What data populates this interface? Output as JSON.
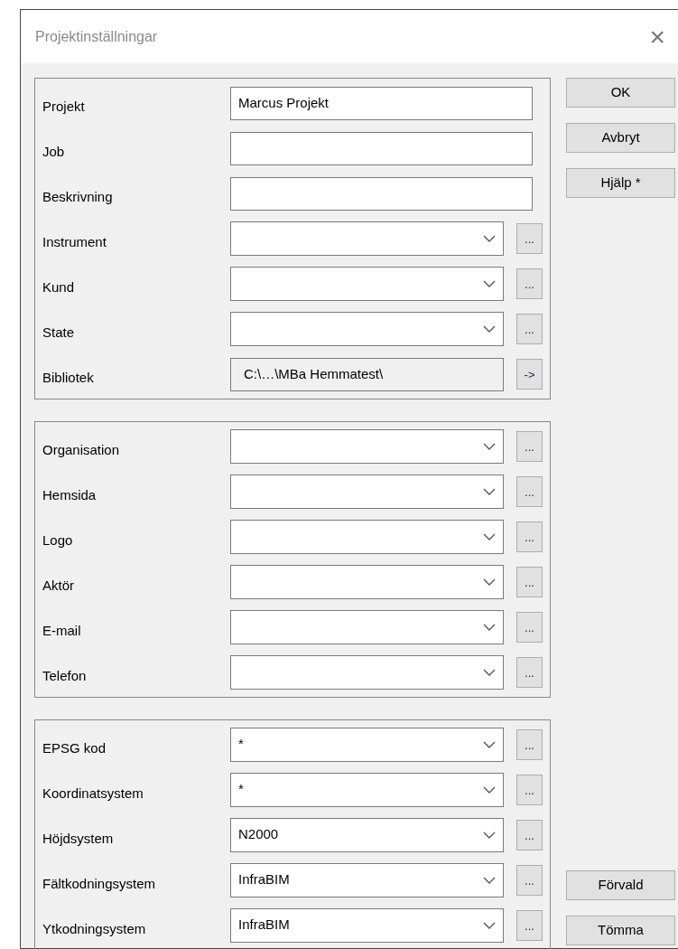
{
  "window": {
    "title": "Projektinställningar",
    "close": "×"
  },
  "groups": [
    {
      "rows": [
        {
          "label": "Projekt",
          "kind": "text",
          "value": "Marcus Projekt"
        },
        {
          "label": "Job",
          "kind": "text",
          "value": ""
        },
        {
          "label": "Beskrivning",
          "kind": "text",
          "value": ""
        },
        {
          "label": "Instrument",
          "kind": "combo",
          "value": "",
          "button": "..."
        },
        {
          "label": "Kund",
          "kind": "combo",
          "value": "",
          "button": "..."
        },
        {
          "label": "State",
          "kind": "combo",
          "value": "",
          "button": "..."
        },
        {
          "label": "Bibliotek",
          "kind": "path",
          "value": "C:\\…\\MBa Hemmatest\\",
          "button": "->"
        }
      ]
    },
    {
      "rows": [
        {
          "label": "Organisation",
          "kind": "combo",
          "value": "",
          "button": "..."
        },
        {
          "label": "Hemsida",
          "kind": "combo",
          "value": "",
          "button": "..."
        },
        {
          "label": "Logo",
          "kind": "combo",
          "value": "",
          "button": "..."
        },
        {
          "label": "Aktör",
          "kind": "combo",
          "value": "",
          "button": "..."
        },
        {
          "label": "E-mail",
          "kind": "combo",
          "value": "",
          "button": "..."
        },
        {
          "label": "Telefon",
          "kind": "combo",
          "value": "",
          "button": "..."
        }
      ]
    },
    {
      "rows": [
        {
          "label": "EPSG kod",
          "kind": "combo",
          "value": "*",
          "button": "..."
        },
        {
          "label": "Koordinatsystem",
          "kind": "combo",
          "value": "*",
          "button": "..."
        },
        {
          "label": "Höjdsystem",
          "kind": "combo",
          "value": "N2000",
          "button": "..."
        },
        {
          "label": "Fältkodningsystem",
          "kind": "combo",
          "value": "InfraBIM",
          "button": "..."
        },
        {
          "label": "Ytkodningsystem",
          "kind": "combo",
          "value": "InfraBIM",
          "button": "..."
        }
      ]
    }
  ],
  "top_buttons": [
    "OK",
    "Avbryt",
    "Hjälp *"
  ],
  "bottom_buttons": [
    "Förvald",
    "Tömma"
  ]
}
